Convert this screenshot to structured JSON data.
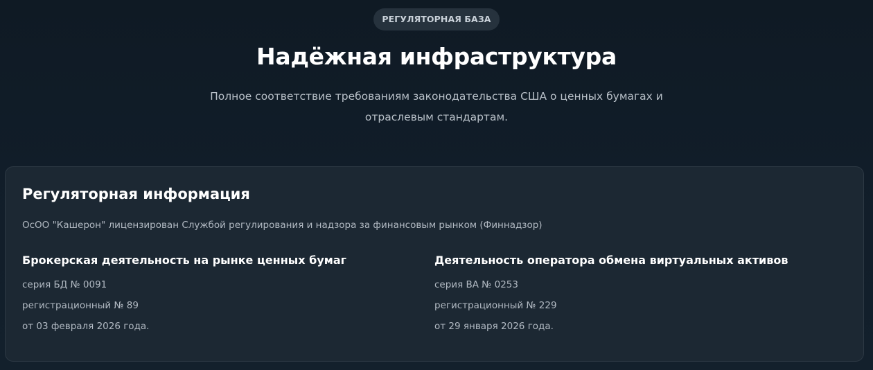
{
  "hero": {
    "badge": "РЕГУЛЯТОРНАЯ БАЗА",
    "title": "Надёжная инфраструктура",
    "subtitle_line1": "Полное соответствие требованиям законодательства США о ценных бумагах и",
    "subtitle_line2": "отраслевым стандартам."
  },
  "card": {
    "title": "Регуляторная информация",
    "description": "ОсОО \"Кашерон\" лицензирован Службой регулирования и надзора за финансовым рынком (Финнадзор)",
    "licenses": [
      {
        "title": "Брокерская деятельность на рынке ценных бумаг",
        "series": "серия БД № 0091",
        "registration": "регистрационный № 89",
        "date": "от 03 февраля 2026 года."
      },
      {
        "title": "Деятельность оператора обмена виртуальных активов",
        "series": "серия ВА № 0253",
        "registration": "регистрационный № 229",
        "date": "от 29 января 2026 года."
      }
    ]
  },
  "colors": {
    "background": "#0f1a24",
    "card_background": "#1c2833",
    "badge_background": "#26323d",
    "text_primary": "#ffffff",
    "text_secondary": "#b2bac3"
  }
}
